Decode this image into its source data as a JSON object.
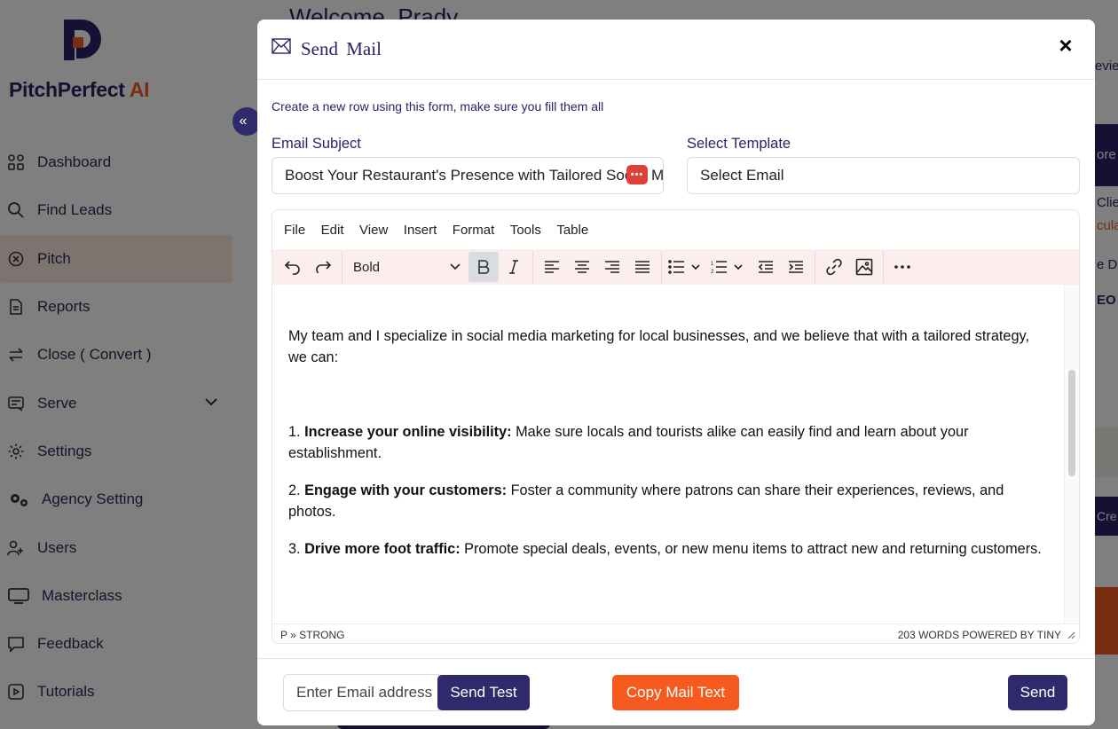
{
  "app": {
    "brand_main": "PitchPerfect",
    "brand_accent": "AI",
    "collapse_icon": "«"
  },
  "sidebar": {
    "items": [
      {
        "label": "Dashboard",
        "icon": "dashboard-icon"
      },
      {
        "label": "Find Leads",
        "icon": "search-icon"
      },
      {
        "label": "Pitch",
        "icon": "pitch-icon"
      },
      {
        "label": "Reports",
        "icon": "document-icon"
      },
      {
        "label": "Close ( Convert )",
        "icon": "transfer-icon"
      },
      {
        "label": "Serve",
        "icon": "serve-icon"
      },
      {
        "label": "Settings",
        "icon": "gear-icon"
      },
      {
        "label": "Agency Setting",
        "icon": "gears-icon"
      },
      {
        "label": "Users",
        "icon": "users-icon"
      },
      {
        "label": "Masterclass",
        "icon": "monitor-icon"
      },
      {
        "label": "Feedback",
        "icon": "chat-icon"
      },
      {
        "label": "Tutorials",
        "icon": "video-icon"
      }
    ]
  },
  "background": {
    "welcome": "Welcome, Prady",
    "right_texts": [
      "evie",
      "ore",
      "Clien",
      "cula",
      "e Do",
      "EO",
      "Cre"
    ]
  },
  "modal": {
    "title": "Send  Mail",
    "close_label": "×",
    "hint": "Create a new row using this form, make sure you fill them all",
    "subject_label": "Email Subject",
    "subject_value": "Boost Your Restaurant's Presence with Tailored Social Media Strategies",
    "template_label": "Select Template",
    "template_value": "Select Email",
    "dots_badge": "•••"
  },
  "editor": {
    "menu": [
      "File",
      "Edit",
      "View",
      "Insert",
      "Format",
      "Tools",
      "Table"
    ],
    "format_value": "Bold",
    "intro": "My team and I specialize in social media marketing for local businesses, and we believe that with a tailored strategy, we can:",
    "items": [
      {
        "num": "1. ",
        "bold": "Increase your online visibility:",
        "text": " Make sure locals and tourists alike can easily find and learn about your establishment."
      },
      {
        "num": "2. ",
        "bold": "Engage with your customers:",
        "text": " Foster a community where patrons can share their experiences, reviews, and photos."
      },
      {
        "num": "3. ",
        "bold": "Drive more foot traffic:",
        "text": " Promote special deals, events, or new menu items to attract new and returning customers."
      }
    ],
    "path": "P » STRONG",
    "status": "203 WORDS  POWERED BY TINY"
  },
  "footer": {
    "email_placeholder": "Enter Email address",
    "send_test": "Send Test",
    "copy": "Copy Mail Text",
    "send": "Send"
  },
  "colors": {
    "brand_dark": "#2a2366",
    "accent_orange": "#f05a22",
    "toolbar_bg": "#fdeeee"
  }
}
